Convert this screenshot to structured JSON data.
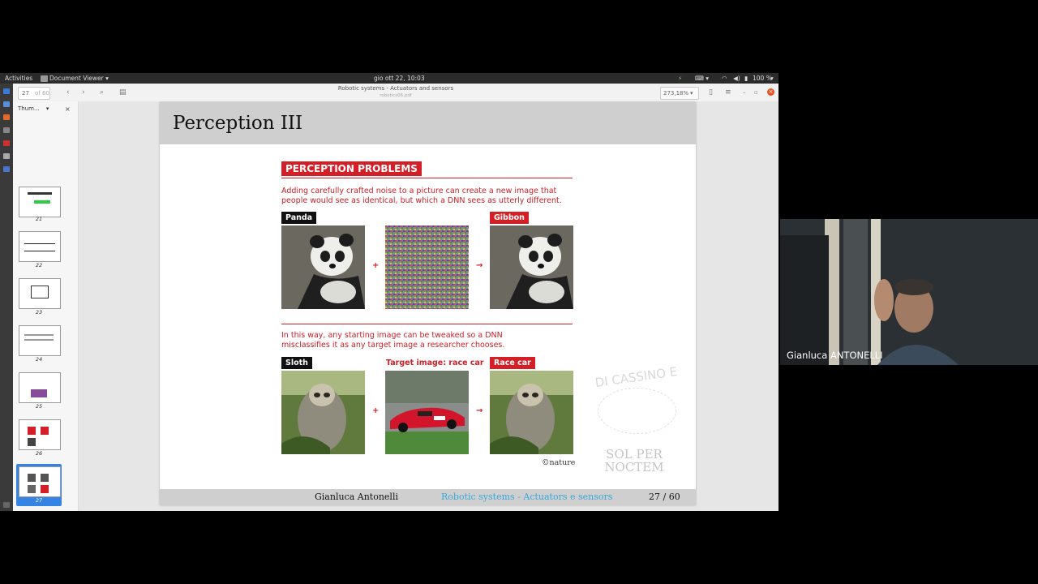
{
  "topbar": {
    "activities": "Activities",
    "app_menu": "Document Viewer",
    "clock": "gio ott 22, 10:03",
    "battery": "100 %"
  },
  "toolbar": {
    "page_current": "27",
    "page_total": "of 60",
    "doc_title": "Robotic systems - Actuators and sensors",
    "doc_file": "robotics06.pdf",
    "zoom": "273,18%"
  },
  "sidebar": {
    "mode": "Thum...",
    "thumbnails": [
      "21",
      "22",
      "23",
      "24",
      "25",
      "26",
      "27",
      "28"
    ],
    "selected": "27"
  },
  "slide": {
    "title": "Perception III",
    "heading": "PERCEPTION PROBLEMS",
    "intro": [
      "Adding carefully crafted noise to a picture can create a new image that",
      "people would see as identical, but which a DNN sees as utterly different."
    ],
    "label_panda": "Panda",
    "label_gibbon": "Gibbon",
    "plus": "+",
    "arrow": "→",
    "middle": [
      "In this way, any starting image can be tweaked so a DNN",
      "misclassifies it as any target image a researcher chooses."
    ],
    "label_sloth": "Sloth",
    "label_target": "Target image: race car",
    "label_racecar": "Race car",
    "credit": "©nature",
    "watermark_top": "DI CASSINO E",
    "watermark_bottom1": "SOL PER",
    "watermark_bottom2": "NOCTEM",
    "footer_author": "Gianluca Antonelli",
    "footer_course": "Robotic systems - Actuators e sensors",
    "footer_page": "27 / 60"
  },
  "webcam": {
    "name": "Gianluca ANTONELLI"
  },
  "colors": {
    "accent_red": "#d51f26",
    "footer_blue": "#3aa7d9",
    "selection_blue": "#3584e4"
  }
}
